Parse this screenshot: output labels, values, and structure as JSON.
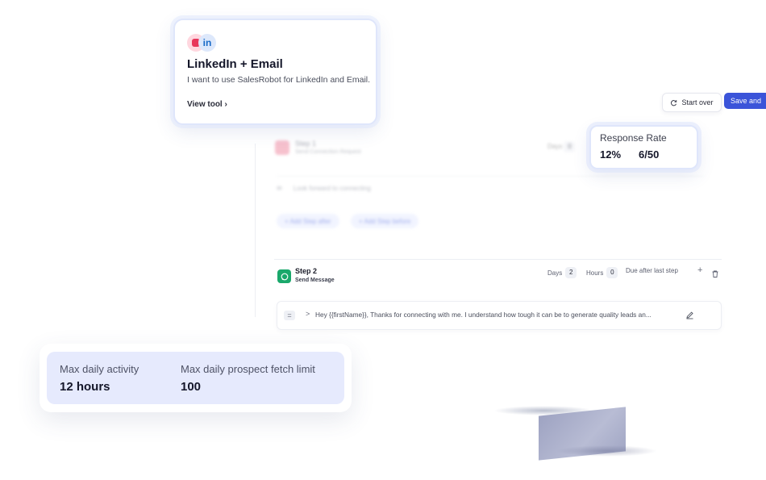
{
  "header": {
    "start_over_label": "Start over",
    "save_label": "Save and"
  },
  "step1": {
    "title": "Step 1",
    "subtitle": "Send Connection Request",
    "days_label": "Days",
    "days_value": "0",
    "message": "Look forward to connecting",
    "add_after_label": "+ Add Step after",
    "add_before_label": "+ Add Step before"
  },
  "step2": {
    "title": "Step 2",
    "subtitle": "Send Message",
    "days_label": "Days",
    "days_value": "2",
    "hours_label": "Hours",
    "hours_value": "0",
    "due_label": "Due after last step",
    "message": "Hey {{firstName}}, Thanks for connecting with me. I understand how tough it can be to generate quality leads an..."
  },
  "linkedin_card": {
    "title": "LinkedIn + Email",
    "description": "I want to use SalesRobot for LinkedIn and Email.",
    "link_label": "View tool",
    "logo_text": "in"
  },
  "response_card": {
    "label": "Response Rate",
    "percent": "12%",
    "ratio": "6/50"
  },
  "activity_card": {
    "daily_activity_label": "Max daily activity",
    "daily_activity_value": "12 hours",
    "fetch_limit_label": "Max daily prospect fetch limit",
    "fetch_limit_value": "100"
  },
  "colors": {
    "primary": "#3b54d9",
    "card_bg": "#e6eafd",
    "step2_icon": "#1aa86b",
    "step1_icon": "#f08fa6",
    "mail_red": "#e8365a",
    "linkedin_blue": "#1769c7"
  }
}
